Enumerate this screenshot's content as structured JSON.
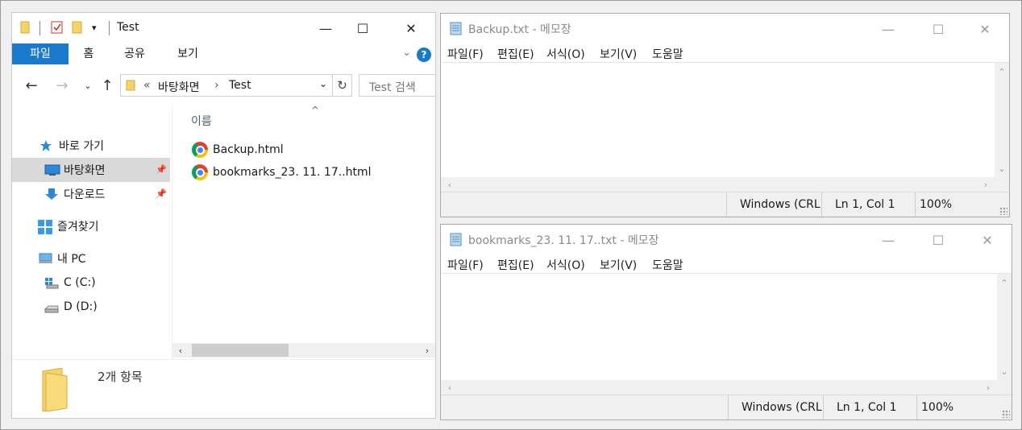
{
  "explorer": {
    "title": "Test",
    "ribbon_tabs": [
      "파일",
      "홈",
      "공유",
      "보기"
    ],
    "address": {
      "overflow": "«",
      "crumbs": [
        "바탕화면",
        "Test"
      ]
    },
    "search_placeholder": "Test 검색",
    "nav": {
      "quick_access": "바로 가기",
      "desktop": "바탕화면",
      "downloads": "다운로드",
      "favorites": "즐겨찾기",
      "this_pc": "내 PC",
      "drive_c": "C (C:)",
      "drive_d": "D (D:)"
    },
    "column_header": "이름",
    "files": [
      "Backup.html",
      "bookmarks_23. 11. 17..html"
    ],
    "status_count": "2개 항목"
  },
  "notepad1": {
    "title": "Backup.txt - 메모장",
    "menu": [
      "파일(F)",
      "편집(E)",
      "서식(O)",
      "보기(V)",
      "도움말"
    ],
    "status": {
      "encoding": "Windows (CRL",
      "position": "Ln 1, Col 1",
      "zoom": "100%"
    }
  },
  "notepad2": {
    "title": "bookmarks_23. 11. 17..txt - 메모장",
    "menu": [
      "파일(F)",
      "편집(E)",
      "서식(O)",
      "보기(V)",
      "도움말"
    ],
    "status": {
      "encoding": "Windows (CRL",
      "position": "Ln 1, Col 1",
      "zoom": "100%"
    }
  },
  "colors": {
    "accent": "#1979ca",
    "selection": "#d9d9d9",
    "folder": "#f5d36b"
  }
}
